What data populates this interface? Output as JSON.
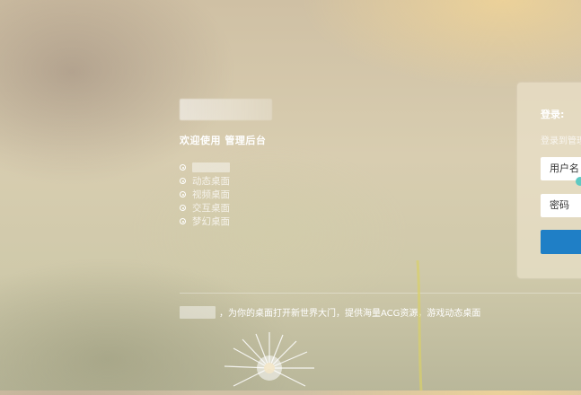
{
  "welcome": "欢迎使用 管理后台",
  "menu": [
    {
      "label": ""
    },
    {
      "label": "动态桌面"
    },
    {
      "label": "视频桌面"
    },
    {
      "label": "交互桌面"
    },
    {
      "label": "梦幻桌面"
    }
  ],
  "footer_text": "，为你的桌面打开新世界大门，提供海量ACG资源，游戏动态桌面",
  "login": {
    "title": "登录:",
    "subtitle": "登录到管理",
    "username_placeholder": "用户名",
    "password_placeholder": "密码"
  }
}
